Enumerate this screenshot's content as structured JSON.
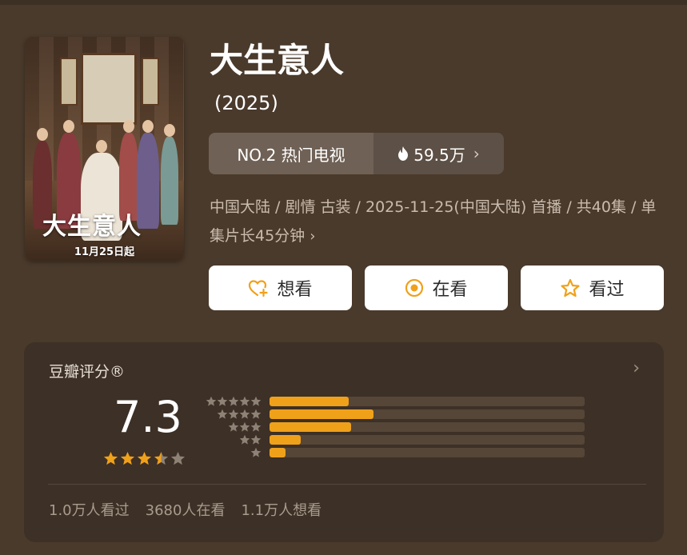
{
  "show": {
    "title": "大生意人",
    "year": "(2025)",
    "poster": {
      "title_art": "大生意人",
      "date": "11月25日起"
    }
  },
  "rank": {
    "label": "NO.2 热门电视",
    "heat": "59.5万"
  },
  "meta": {
    "line": "中国大陆 / 剧情 古装 / 2025-11-25(中国大陆) 首播 / 共40集 / 单集片长45分钟"
  },
  "actions": {
    "want": "想看",
    "watching": "在看",
    "watched": "看过"
  },
  "rating": {
    "header": "豆瓣评分®",
    "score": "7.3",
    "star_value": 3.5,
    "distribution": [
      {
        "stars": 5,
        "fraction": 0.25
      },
      {
        "stars": 4,
        "fraction": 0.33
      },
      {
        "stars": 3,
        "fraction": 0.26
      },
      {
        "stars": 2,
        "fraction": 0.1
      },
      {
        "stars": 1,
        "fraction": 0.05
      }
    ],
    "stats": {
      "watched": "1.0万人看过",
      "watching": "3680人在看",
      "want": "1.1万人想看"
    }
  },
  "colors": {
    "accent": "#f0a11a",
    "background": "#4a3a2c",
    "card": "#3d3026"
  }
}
